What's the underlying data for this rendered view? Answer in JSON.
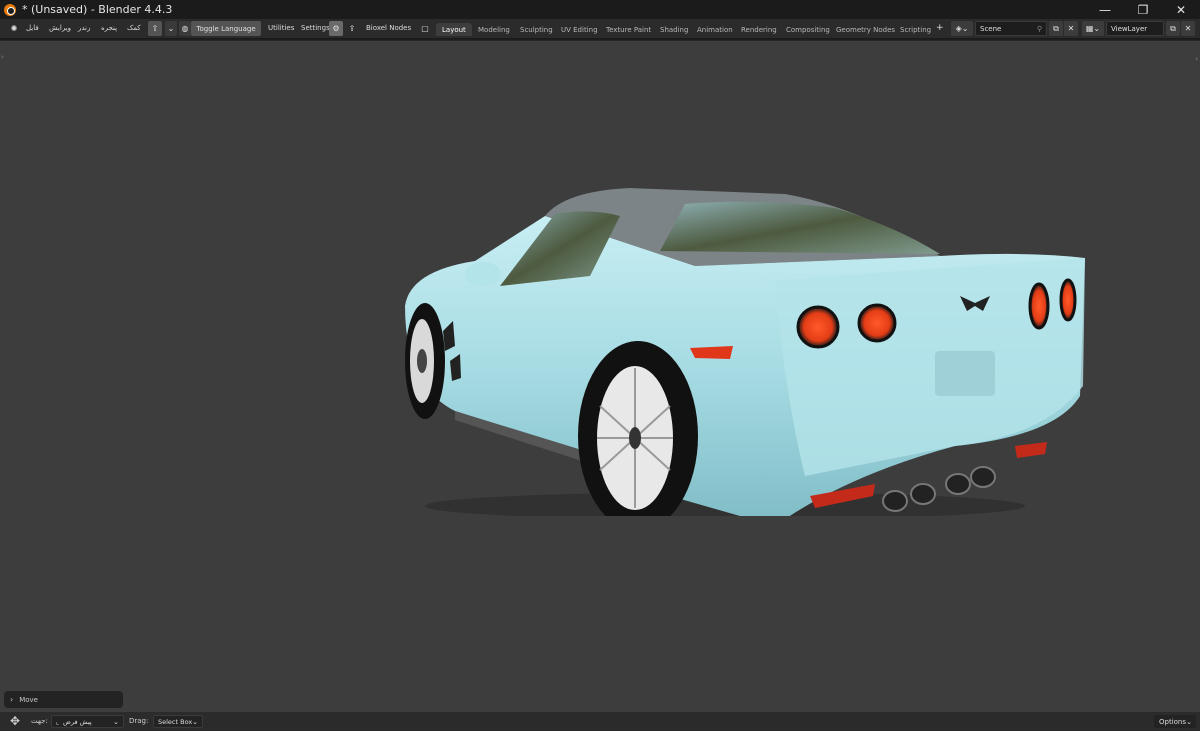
{
  "window": {
    "title": "* (Unsaved) - Blender 4.4.3",
    "min_icon": "minimize-icon",
    "max_icon": "restore-icon",
    "close_icon": "close-icon",
    "min_glyph": "—",
    "max_glyph": "❐",
    "close_glyph": "✕"
  },
  "menus": {
    "file": "فایل",
    "edit": "ویرایش",
    "render": "رندر",
    "window": "پنجره",
    "help": "کمک"
  },
  "toolbar": {
    "toggle_language": "Toggle Language",
    "utilities": "Utilities",
    "settings": "Settings",
    "bioxel_nodes": "Bioxel Nodes"
  },
  "workspace_tabs": [
    {
      "label": "Layout",
      "active": true
    },
    {
      "label": "Modeling",
      "active": false
    },
    {
      "label": "Sculpting",
      "active": false
    },
    {
      "label": "UV Editing",
      "active": false
    },
    {
      "label": "Texture Paint",
      "active": false
    },
    {
      "label": "Shading",
      "active": false
    },
    {
      "label": "Animation",
      "active": false
    },
    {
      "label": "Rendering",
      "active": false
    },
    {
      "label": "Compositing",
      "active": false
    },
    {
      "label": "Geometry Nodes",
      "active": false
    },
    {
      "label": "Scripting",
      "active": false
    }
  ],
  "add_tab": "+",
  "scene": {
    "name": "Scene"
  },
  "view_layer": {
    "name": "ViewLayer"
  },
  "operator_panel": {
    "label": "Move"
  },
  "statusbar": {
    "direction_label": "جهت:",
    "direction_value": "پیش فرض",
    "drag_label": "Drag:",
    "drag_value": "Select Box",
    "options": "Options"
  },
  "colors": {
    "car_body": "#a8dce3",
    "viewport_bg": "#3d3d3d",
    "accent": "#e87d0d"
  }
}
